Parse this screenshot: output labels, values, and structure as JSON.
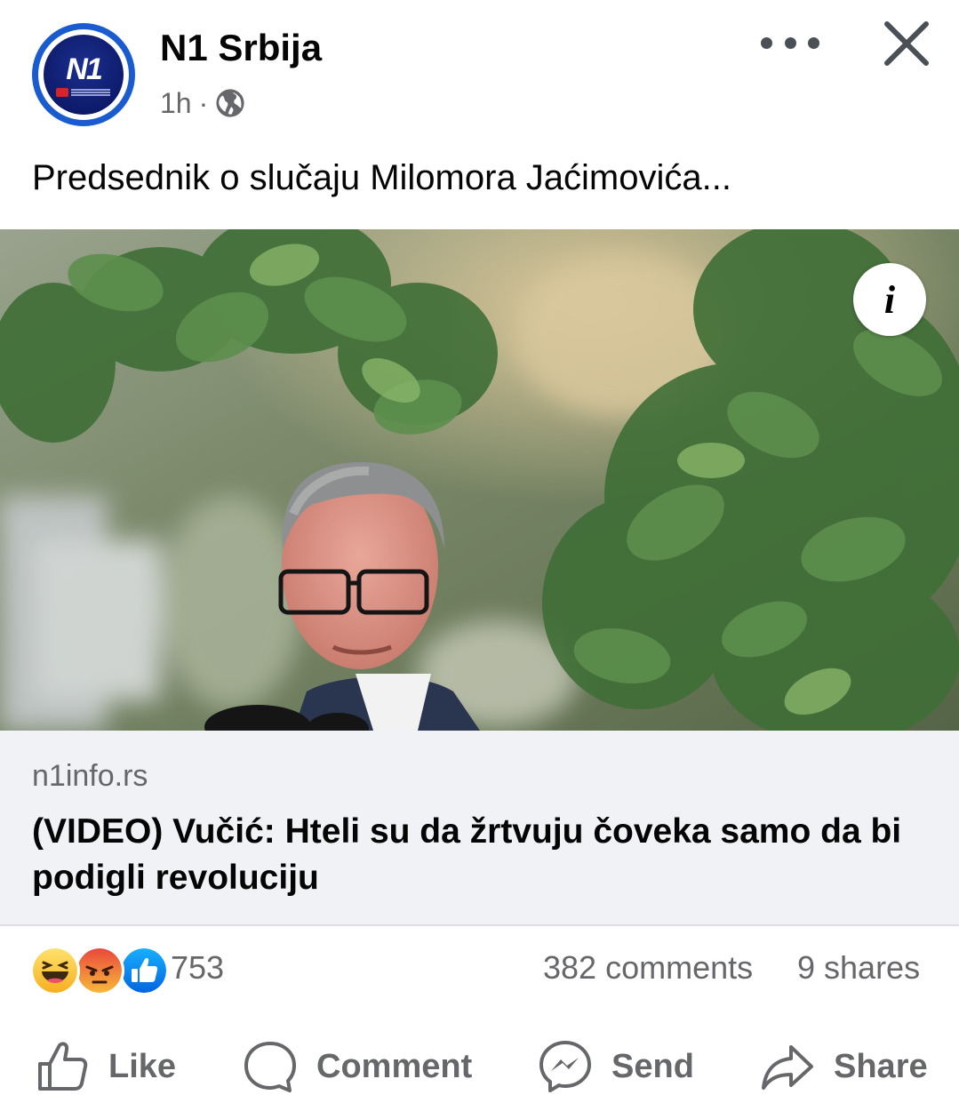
{
  "post": {
    "page_name": "N1 Srbija",
    "time": "1h",
    "separator": "·",
    "text": "Predsednik o slučaju Milomora Jaćimovića...",
    "avatar_text": "N1"
  },
  "link": {
    "domain": "n1info.rs",
    "title": "(VIDEO) Vučić: Hteli su da žrtvuju čoveka samo da bi podigli revoluciju"
  },
  "stats": {
    "reactions": [
      "haha",
      "angry",
      "like"
    ],
    "reaction_count": "753",
    "comments": "382 comments",
    "shares": "9 shares"
  },
  "actions": {
    "like": "Like",
    "comment": "Comment",
    "send": "Send",
    "share": "Share"
  },
  "colors": {
    "brand_blue": "#1a5cd0",
    "link_bg": "#f0f2f5",
    "secondary_text": "#65676b"
  }
}
